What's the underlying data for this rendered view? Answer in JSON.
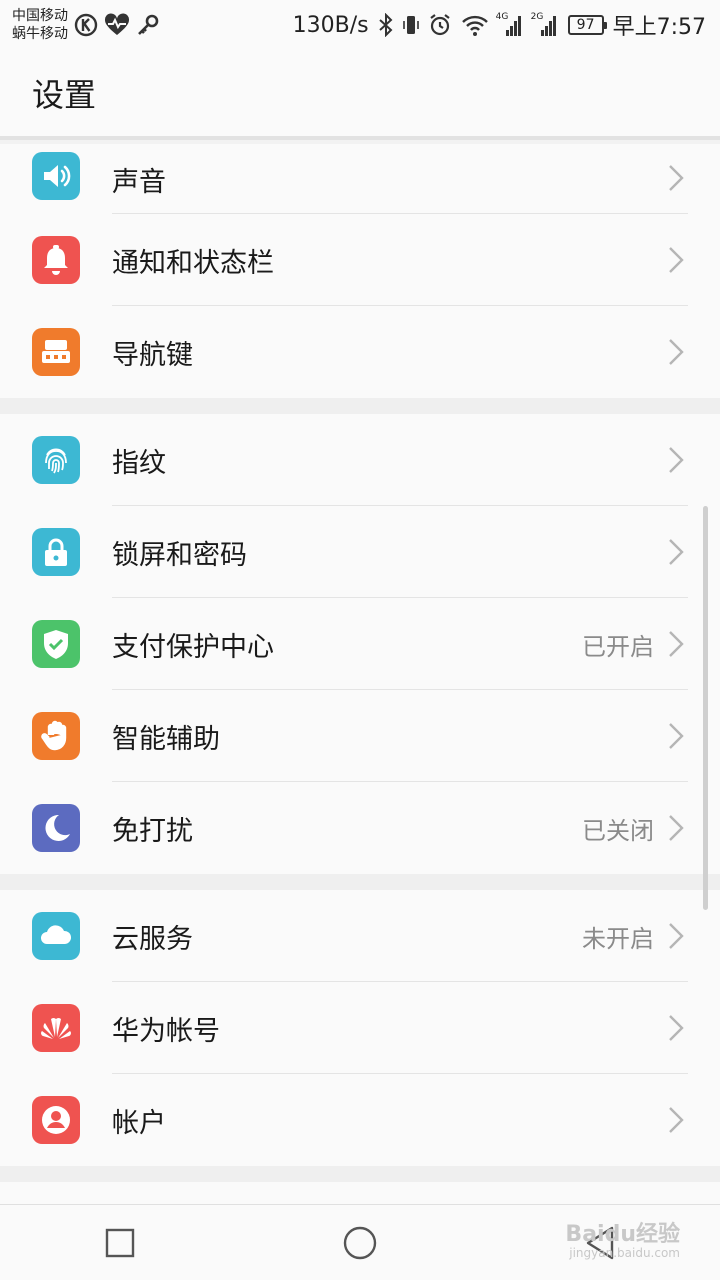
{
  "status_bar": {
    "carrier_1": "中国移动",
    "carrier_2": "蜗牛移动",
    "speed": "130B/s",
    "net_1": "4G",
    "net_2": "2G",
    "battery": "97",
    "time": "早上7:57"
  },
  "header": {
    "title": "设置"
  },
  "groups": [
    {
      "items": [
        {
          "label": "声音",
          "icon": "speaker-icon",
          "color": "#3db8d3"
        },
        {
          "label": "通知和状态栏",
          "icon": "bell-icon",
          "color": "#ef5350"
        },
        {
          "label": "导航键",
          "icon": "navigation-key-icon",
          "color": "#f07b2c"
        }
      ]
    },
    {
      "items": [
        {
          "label": "指纹",
          "icon": "fingerprint-icon",
          "color": "#3db8d3"
        },
        {
          "label": "锁屏和密码",
          "icon": "lock-icon",
          "color": "#3db8d3"
        },
        {
          "label": "支付保护中心",
          "value": "已开启",
          "icon": "shield-check-icon",
          "color": "#4cc36a"
        },
        {
          "label": "智能辅助",
          "icon": "hand-icon",
          "color": "#f07b2c"
        },
        {
          "label": "免打扰",
          "value": "已关闭",
          "icon": "moon-icon",
          "color": "#5c6bc0"
        }
      ]
    },
    {
      "items": [
        {
          "label": "云服务",
          "value": "未开启",
          "icon": "cloud-icon",
          "color": "#3db8d3"
        },
        {
          "label": "华为帐号",
          "icon": "huawei-logo-icon",
          "color": "#ef5350"
        },
        {
          "label": "帐户",
          "icon": "user-icon",
          "color": "#ef5350"
        }
      ]
    }
  ],
  "watermark": {
    "brand": "Baidu经验",
    "url": "jingyan.baidu.com"
  }
}
